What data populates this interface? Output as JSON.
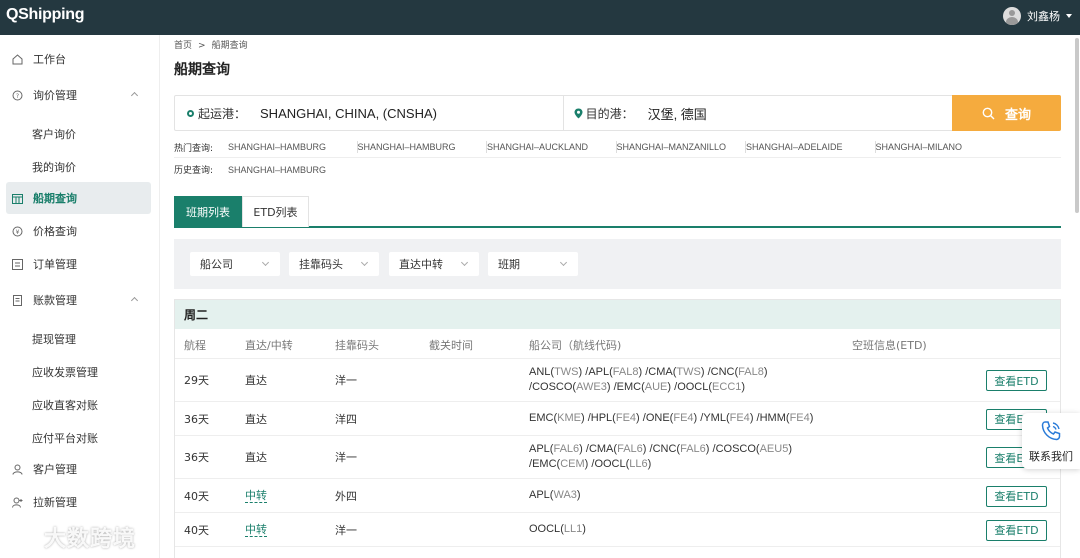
{
  "app": {
    "logo": "QShipping",
    "user_name": "刘鑫杨"
  },
  "sidebar": {
    "items": [
      {
        "label": "工作台",
        "icon": "home-icon"
      },
      {
        "label": "询价管理",
        "icon": "inquiry-icon"
      },
      {
        "label": "客户询价",
        "sub": true
      },
      {
        "label": "我的询价",
        "sub": true
      },
      {
        "label": "船期查询",
        "icon": "calendar-icon",
        "active": true
      },
      {
        "label": "价格查询",
        "icon": "price-icon"
      },
      {
        "label": "订单管理",
        "icon": "order-icon"
      },
      {
        "label": "账款管理",
        "icon": "account-icon"
      },
      {
        "label": "提现管理",
        "sub": true
      },
      {
        "label": "应收发票管理",
        "sub": true
      },
      {
        "label": "应收直客对账",
        "sub": true
      },
      {
        "label": "应付平台对账",
        "sub": true
      },
      {
        "label": "客户管理",
        "icon": "customer-icon"
      },
      {
        "label": "拉新管理",
        "icon": "referral-icon"
      }
    ]
  },
  "breadcrumb": {
    "home": "首页",
    "sep": ">",
    "current": "船期查询"
  },
  "page_title": "船期查询",
  "search": {
    "origin_label": "起运港：",
    "origin_value": "SHANGHAI, CHINA, (CNSHA)",
    "dest_label": "目的港：",
    "dest_value": "汉堡, 德国",
    "button": "查询"
  },
  "hot": {
    "label": "热门查询:",
    "items": [
      "SHANGHAI–HAMBURG",
      "SHANGHAI–HAMBURG",
      "SHANGHAI–AUCKLAND",
      "SHANGHAI–MANZANILLO",
      "SHANGHAI–ADELAIDE",
      "SHANGHAI–MILANO"
    ]
  },
  "history": {
    "label": "历史查询:",
    "items": [
      "SHANGHAI–HAMBURG"
    ]
  },
  "tabs": [
    "班期列表",
    "ETD列表"
  ],
  "filters": [
    "船公司",
    "挂靠码头",
    "直达中转",
    "班期"
  ],
  "table": {
    "day": "周二",
    "headers": [
      "航程",
      "直达/中转",
      "挂靠码头",
      "截关时间",
      "船公司（航线代码)",
      "空班信息(ETD)"
    ],
    "etd_button": "查看ETD",
    "rows": [
      {
        "duration": "29天",
        "type": "直达",
        "terminal": "洋一",
        "carriers": [
          [
            "ANL",
            "TWS"
          ],
          [
            "APL",
            "FAL8"
          ],
          [
            "CMA",
            "TWS"
          ],
          [
            "CNC",
            "FAL8"
          ],
          [
            "COSCO",
            "AWE3"
          ],
          [
            "EMC",
            "AUE"
          ],
          [
            "OOCL",
            "ECC1"
          ]
        ]
      },
      {
        "duration": "36天",
        "type": "直达",
        "terminal": "洋四",
        "carriers": [
          [
            "EMC",
            "KME"
          ],
          [
            "HPL",
            "FE4"
          ],
          [
            "ONE",
            "FE4"
          ],
          [
            "YML",
            "FE4"
          ],
          [
            "HMM",
            "FE4"
          ]
        ]
      },
      {
        "duration": "36天",
        "type": "直达",
        "terminal": "洋一",
        "carriers": [
          [
            "APL",
            "FAL6"
          ],
          [
            "CMA",
            "FAL6"
          ],
          [
            "CNC",
            "FAL6"
          ],
          [
            "COSCO",
            "AEU5"
          ],
          [
            "EMC",
            "CEM"
          ],
          [
            "OOCL",
            "LL6"
          ]
        ]
      },
      {
        "duration": "40天",
        "type": "中转",
        "terminal": "外四",
        "carriers": [
          [
            "APL",
            "WA3"
          ]
        ]
      },
      {
        "duration": "40天",
        "type": "中转",
        "terminal": "洋一",
        "carriers": [
          [
            "OOCL",
            "LL1"
          ]
        ]
      }
    ]
  },
  "contact": "联系我们",
  "watermark": "大数跨境"
}
